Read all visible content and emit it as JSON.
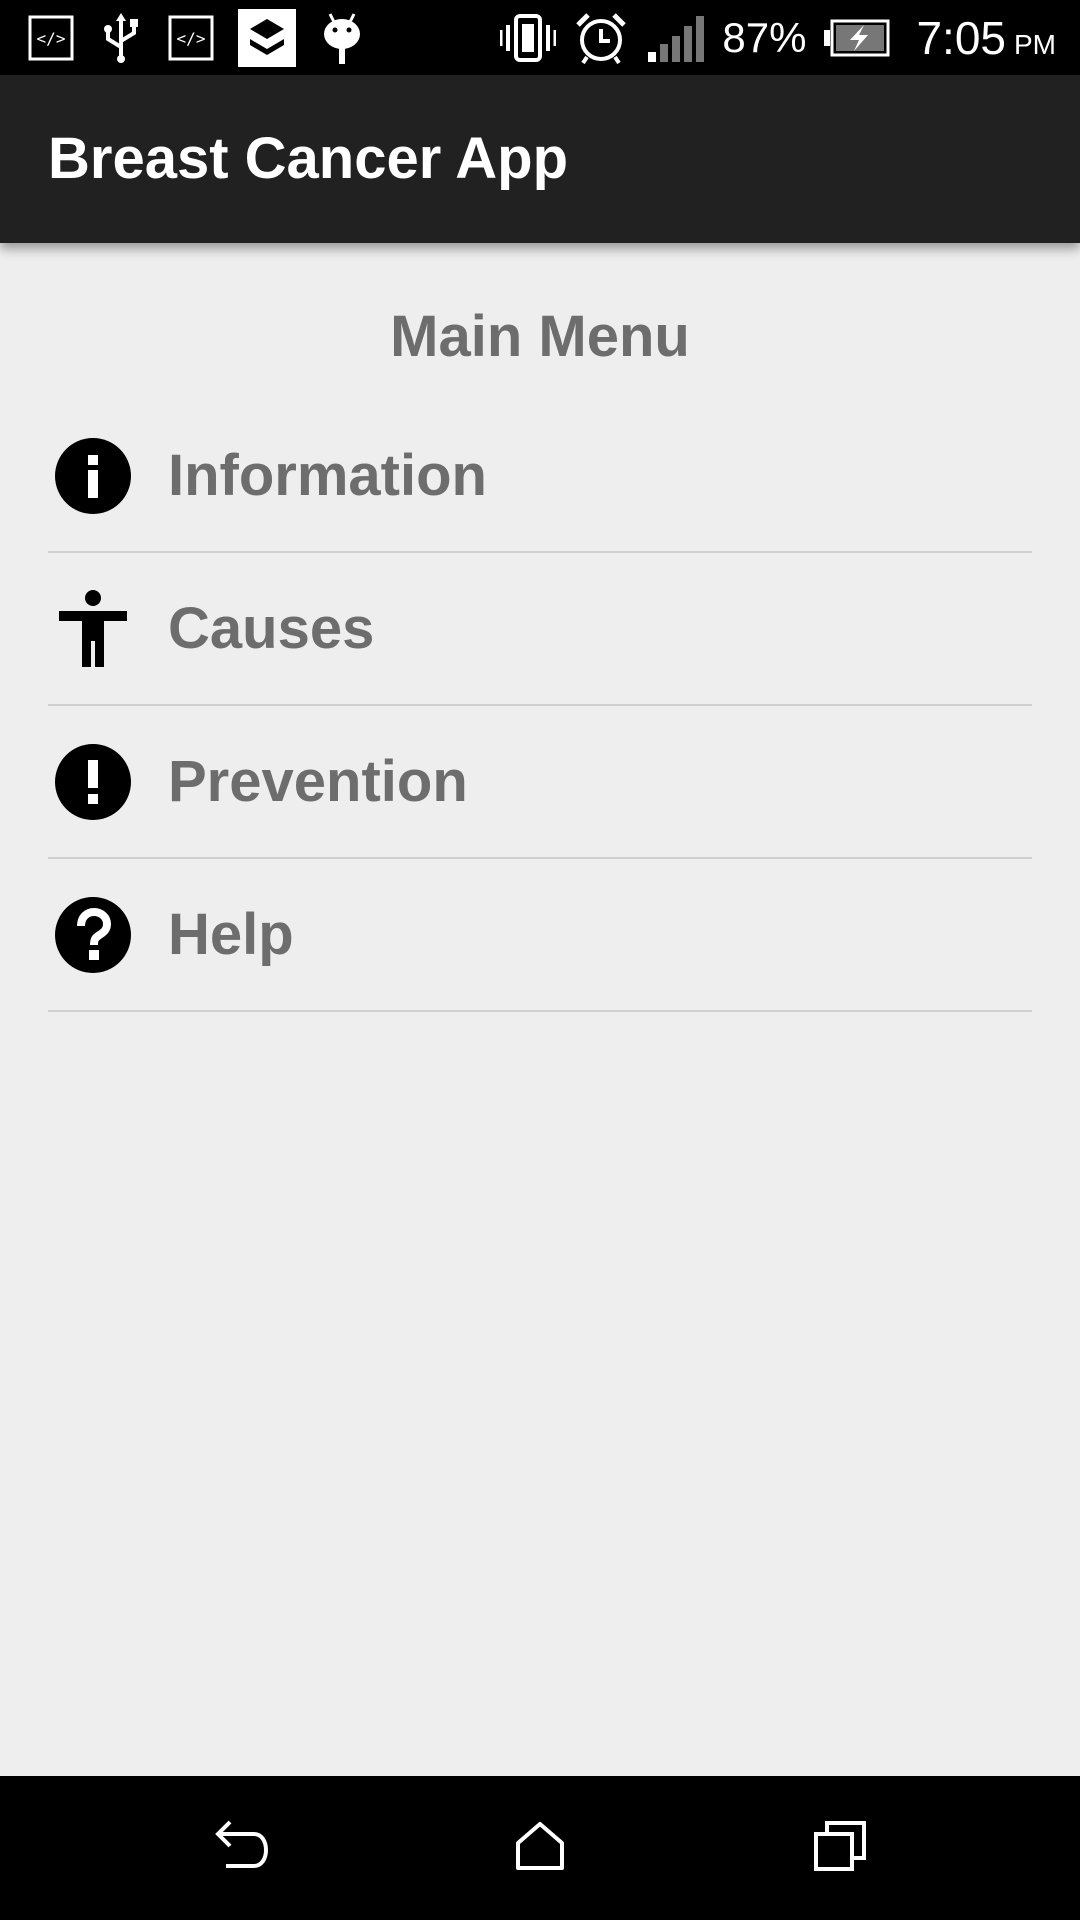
{
  "status_bar": {
    "battery_percent": "87%",
    "time": "7:05",
    "ampm": "PM",
    "icons_left": [
      "code-icon",
      "usb-icon",
      "code-icon",
      "app-notification-icon",
      "android-icon"
    ],
    "icons_right": [
      "vibrate-icon",
      "alarm-icon",
      "signal-icon",
      "battery-charging-icon"
    ]
  },
  "app_bar": {
    "title": "Breast Cancer App"
  },
  "main": {
    "title": "Main Menu",
    "items": [
      {
        "label": "Information",
        "icon": "info-icon"
      },
      {
        "label": "Causes",
        "icon": "person-icon"
      },
      {
        "label": "Prevention",
        "icon": "exclamation-icon"
      },
      {
        "label": "Help",
        "icon": "help-icon"
      }
    ]
  },
  "nav_bar": {
    "buttons": [
      "back-icon",
      "home-icon",
      "recents-icon"
    ]
  },
  "colors": {
    "status_bar": "#000000",
    "app_bar": "#212121",
    "background": "#eeeeee",
    "menu_text": "#6d6d6d",
    "divider": "#d0d0d0"
  }
}
